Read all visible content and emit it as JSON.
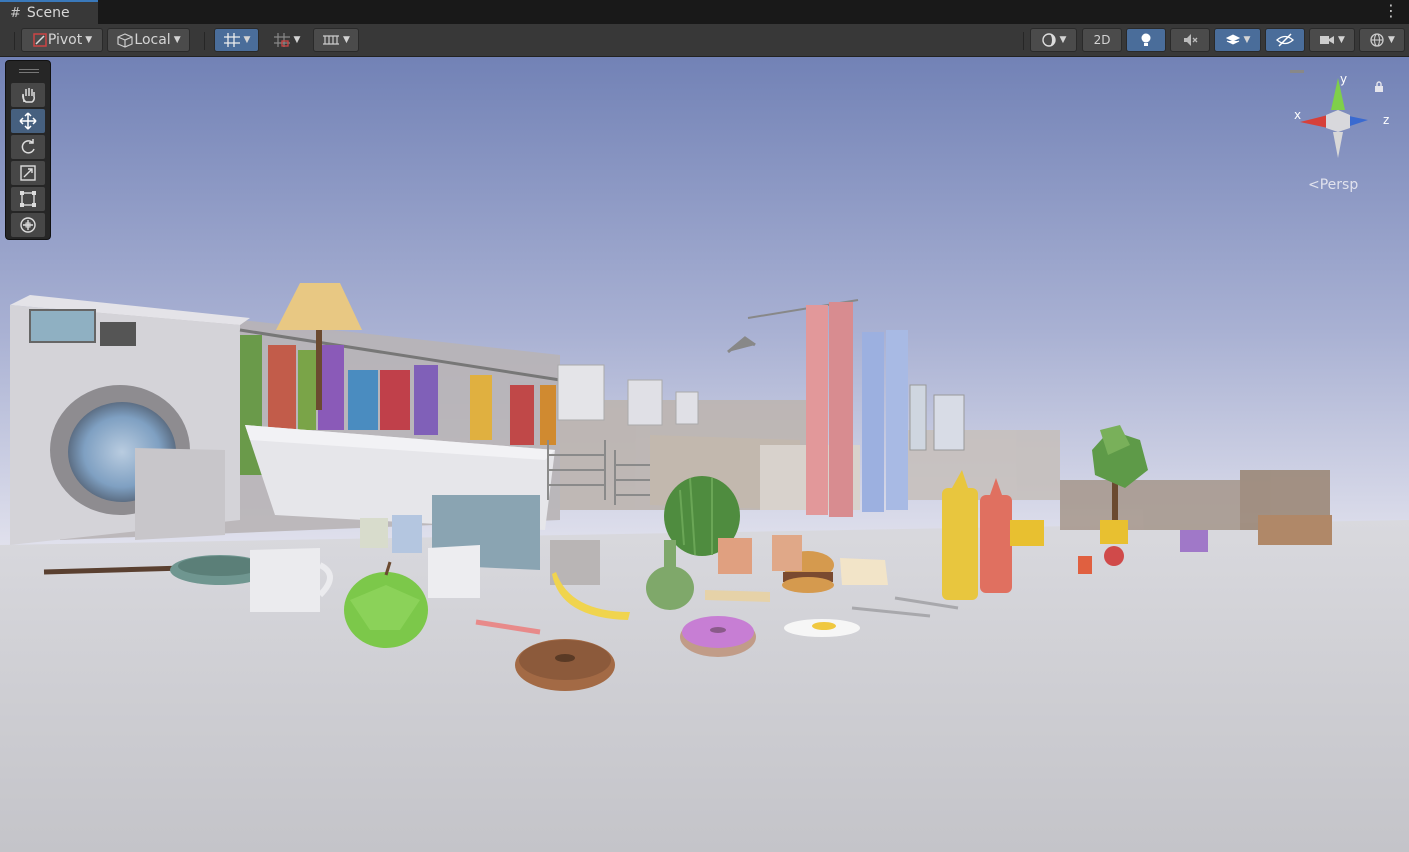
{
  "window": {
    "tab_title": "Scene",
    "tab_icon": "hash-icon",
    "menu_icon": "kebab-menu-icon"
  },
  "toolbar": {
    "pivot_label": "Pivot",
    "local_label": "Local",
    "mode_2d_label": "2D"
  },
  "tools": [
    "hand-tool",
    "move-tool",
    "rotate-tool",
    "scale-tool",
    "rect-tool",
    "transform-tool"
  ],
  "gizmo": {
    "x_label": "x",
    "y_label": "y",
    "z_label": "z",
    "projection_label": "Persp"
  },
  "colors": {
    "sky_top": "#7787b8",
    "sky_bottom": "#dfe0ec",
    "ground": "#cfcfd4",
    "accent": "#3a79bb"
  }
}
